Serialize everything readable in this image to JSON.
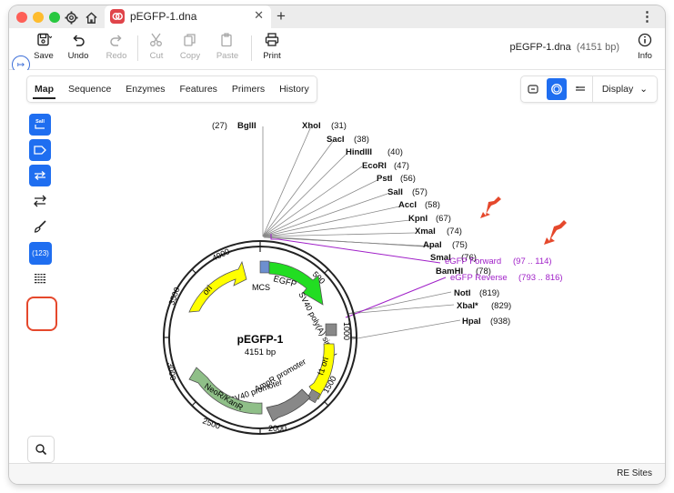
{
  "tab": {
    "title": "pEGFP-1.dna"
  },
  "toolbar": {
    "save": "Save",
    "undo": "Undo",
    "redo": "Redo",
    "cut": "Cut",
    "copy": "Copy",
    "paste": "Paste",
    "print": "Print",
    "info": "Info",
    "doc_name": "pEGFP-1.dna",
    "doc_size": "(4151 bp)"
  },
  "view_tabs": [
    "Map",
    "Sequence",
    "Enzymes",
    "Features",
    "Primers",
    "History"
  ],
  "display_label": "Display",
  "tools": {
    "enzyme_badge": "(123)"
  },
  "map": {
    "name": "pEGFP-1",
    "size": "4151 bp",
    "ticks": [
      "500",
      "1000",
      "1500",
      "2000",
      "2500",
      "3000",
      "3500",
      "4000"
    ],
    "features": [
      "ori",
      "EGFP",
      "MCS",
      "SV40 poly(A) signal",
      "f1 ori",
      "AmpR promoter",
      "SV40 promoter",
      "NeoR/KanR"
    ],
    "sites": [
      {
        "pos": "(27)",
        "name": "BglII"
      },
      {
        "name": "XhoI",
        "pos": "(31)"
      },
      {
        "name": "SacI",
        "pos": "(38)"
      },
      {
        "name": "HindIII",
        "pos": "(40)"
      },
      {
        "name": "EcoRI",
        "pos": "(47)"
      },
      {
        "name": "PstI",
        "pos": "(56)"
      },
      {
        "name": "SalI",
        "pos": "(57)"
      },
      {
        "name": "AccI",
        "pos": "(58)"
      },
      {
        "name": "KpnI",
        "pos": "(67)"
      },
      {
        "name": "XmaI",
        "pos": "(74)"
      },
      {
        "name": "ApaI",
        "pos": "(75)"
      },
      {
        "name": "SmaI",
        "pos": "(76)"
      },
      {
        "name": "BamHI",
        "pos": "(78)"
      },
      {
        "name": "NotI",
        "pos": "(819)"
      },
      {
        "name": "XbaI*",
        "pos": "(829)"
      },
      {
        "name": "HpaI",
        "pos": "(938)"
      }
    ],
    "primers": [
      {
        "name": "eGFP Forward",
        "range": "(97 .. 114)"
      },
      {
        "name": "eGFP Reverse",
        "range": "(793 .. 816)"
      }
    ]
  },
  "status": {
    "text": "RE Sites"
  },
  "colors": {
    "accent": "#1f6ef0",
    "primer": "#a020c8",
    "highlight": "#e5482c"
  }
}
